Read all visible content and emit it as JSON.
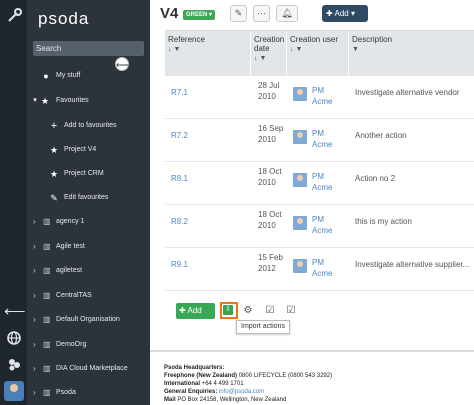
{
  "app": {
    "logo_text": "psoda"
  },
  "rail": {
    "icons": [
      "wrench-icon",
      "logout-icon",
      "globe-icon",
      "group-icon",
      "user-avatar"
    ]
  },
  "sidebar": {
    "search_placeholder": "Search",
    "items": [
      {
        "label": "My stuff",
        "icon": "user-icon"
      },
      {
        "label": "Favourites",
        "icon": "star-icon",
        "chevron": "chevron-down-icon"
      },
      {
        "label": "Add to favourites",
        "icon": "plus-icon"
      },
      {
        "label": "Project V4",
        "icon": "star-icon"
      },
      {
        "label": "Project CRM",
        "icon": "star-icon"
      },
      {
        "label": "Edit favourites",
        "icon": "pencil-icon"
      }
    ],
    "orgs": [
      {
        "label": "agency 1"
      },
      {
        "label": "Agile test"
      },
      {
        "label": "agiletest"
      },
      {
        "label": "CentralTAS"
      },
      {
        "label": "Default Organisation"
      },
      {
        "label": "DemoOrg"
      },
      {
        "label": "DIA Cloud Marketplace"
      },
      {
        "label": "Psoda"
      }
    ]
  },
  "header": {
    "title": "V4",
    "status_badge": "GREEN",
    "add_label": "Add"
  },
  "table": {
    "columns": [
      "Reference",
      "Creation date",
      "Creation user",
      "Description"
    ],
    "rows": [
      {
        "ref": "R7.1",
        "date_line1": "28 Jul",
        "date_line2": "2010",
        "user_line1": "PM",
        "user_line2": "Acme",
        "description": "Investigate alternative vendor"
      },
      {
        "ref": "R7.2",
        "date_line1": "16 Sep",
        "date_line2": "2010",
        "user_line1": "PM",
        "user_line2": "Acme",
        "description": "Another action"
      },
      {
        "ref": "R8.1",
        "date_line1": "18 Oct",
        "date_line2": "2010",
        "user_line1": "PM",
        "user_line2": "Acme",
        "description": "Action no 2"
      },
      {
        "ref": "R8.2",
        "date_line1": "18 Oct",
        "date_line2": "2010",
        "user_line1": "PM",
        "user_line2": "Acme",
        "description": "this is my action"
      },
      {
        "ref": "R9.1",
        "date_line1": "15 Feb",
        "date_line2": "2012",
        "user_line1": "PM",
        "user_line2": "Acme",
        "description": "Investigate alternative supplier..."
      }
    ]
  },
  "actions": {
    "add_label": "Add",
    "import_tooltip": "Import actions"
  },
  "footer": {
    "heading": "Psoda Headquarters:",
    "freephone_label": "Freephone (New Zealand)",
    "freephone_value": "0800 LIFECYCLE (0800 543 3292)",
    "international_label": "International",
    "international_value": "+64 4 499 1701",
    "enquiries_label": "General Enquiries:",
    "enquiries_value": "info@psoda.com",
    "mail_label": "Mail",
    "mail_value": "PO Box 24158, Wellington, New Zealand"
  },
  "colors": {
    "sidebar_bg": "#2c333b",
    "rail_bg": "#1f262e",
    "status_green": "#3aa756",
    "header_button": "#2e4b63",
    "link_blue": "#4a86c5",
    "highlight_orange": "#e87a1e"
  }
}
